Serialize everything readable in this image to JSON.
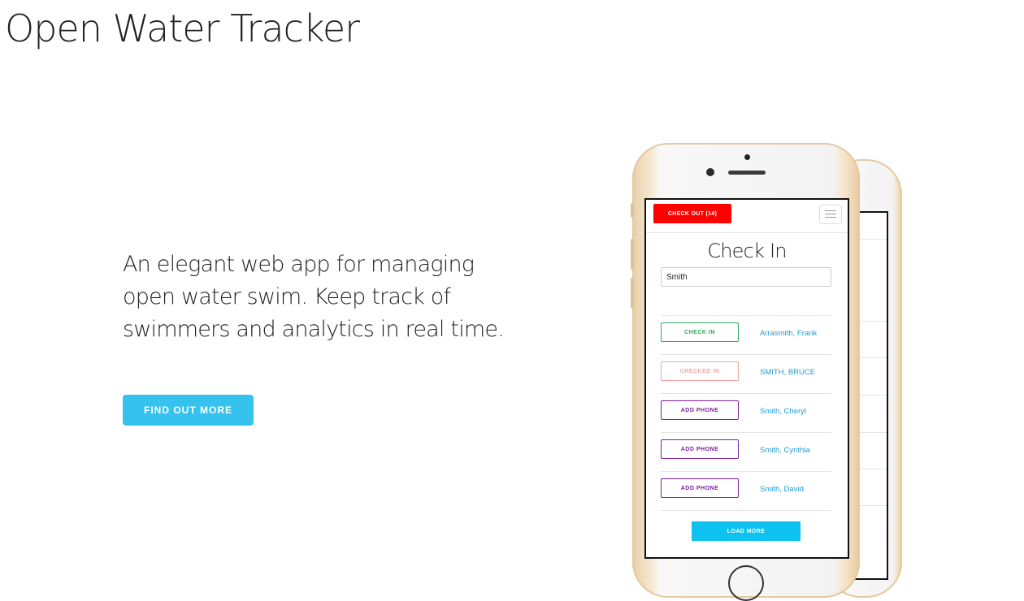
{
  "site": {
    "title": "Open Water Tracker"
  },
  "hero": {
    "text": "An elegant web app for managing open water swim. Keep track of swimmers and analytics in real time.",
    "cta_label": "FIND OUT MORE"
  },
  "colors": {
    "accent": "#35c2ee",
    "checkout": "#ff0000",
    "check_in": "#2eaa5c",
    "checked_in": "#f4a3a3",
    "add_phone": "#7a1fa0",
    "link": "#1e9bd7",
    "load_more": "#0ec2f0"
  },
  "app": {
    "checkout_label": "CHECK OUT (14)",
    "menu_icon": "hamburger-menu-icon",
    "title": "Check In",
    "search_value": "Smith",
    "rows": [
      {
        "action": "CHECK IN",
        "status": "check_in",
        "name": "Arrasmith, Frank"
      },
      {
        "action": "CHECKED IN",
        "status": "checked_in",
        "name": "SMITH, BRUCE"
      },
      {
        "action": "ADD PHONE",
        "status": "add_phone",
        "name": "Smith, Cheryl"
      },
      {
        "action": "ADD PHONE",
        "status": "add_phone",
        "name": "Smith, Cynthia"
      },
      {
        "action": "ADD PHONE",
        "status": "add_phone",
        "name": "Smith, David"
      }
    ],
    "load_more_label": "LOAD MORE"
  }
}
